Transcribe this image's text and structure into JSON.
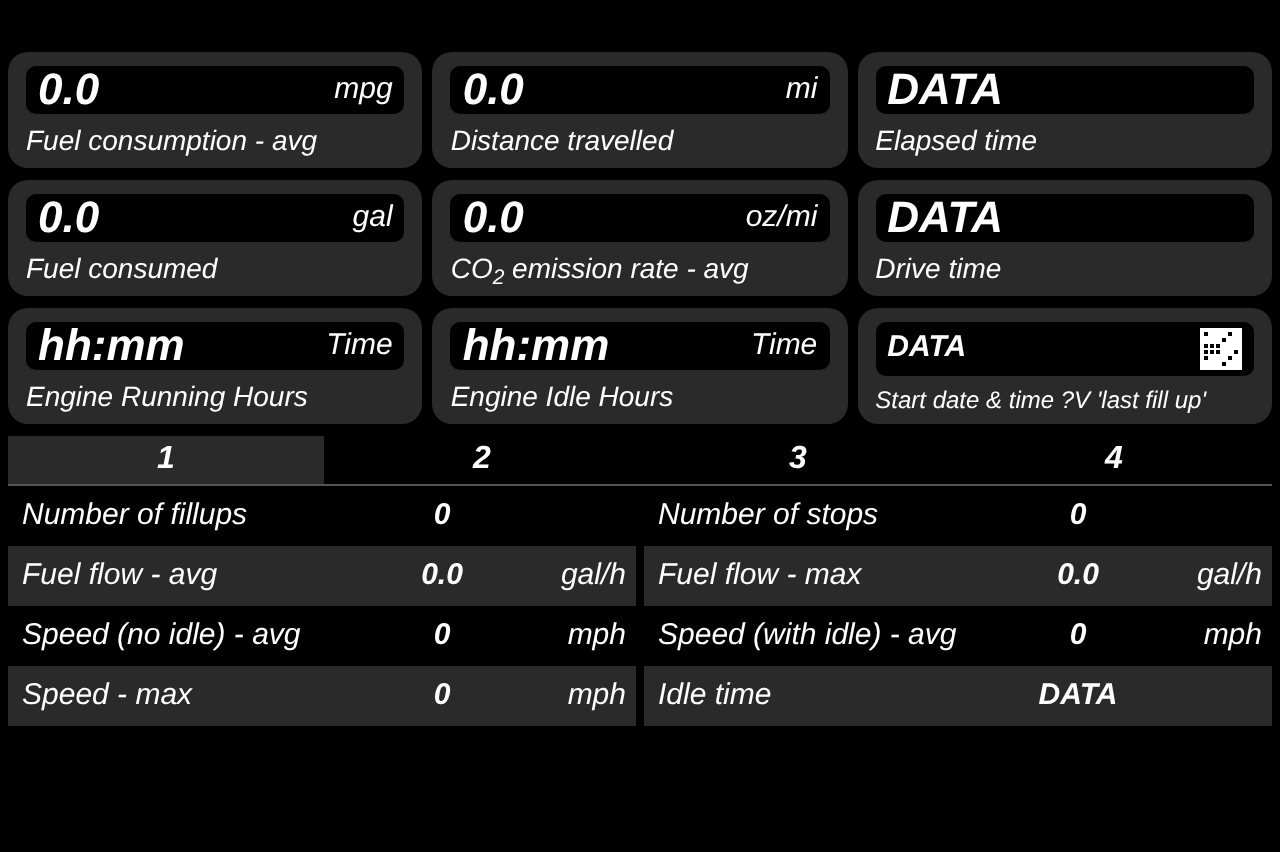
{
  "cards": [
    {
      "kind": "value",
      "value": "0.0",
      "unit": "mpg",
      "label": "Fuel consumption - avg"
    },
    {
      "kind": "value",
      "value": "0.0",
      "unit": "mi",
      "label": "Distance travelled"
    },
    {
      "kind": "value",
      "value": "DATA",
      "label": "Elapsed time"
    },
    {
      "kind": "value",
      "value": "0.0",
      "unit": "gal",
      "label": "Fuel consumed"
    },
    {
      "kind": "value",
      "value": "0.0",
      "unit": "oz/mi",
      "label": "CO$_{2}$ emission rate - avg"
    },
    {
      "kind": "value",
      "value": "DATA",
      "label": "Drive time"
    },
    {
      "kind": "value",
      "value": "hh:mm",
      "unit": "Time",
      "label": "Engine Running Hours"
    },
    {
      "kind": "value",
      "value": "hh:mm",
      "unit": "Time",
      "label": "Engine Idle Hours"
    },
    {
      "kind": "small",
      "value": "DATA",
      "label": "Start date & time ?V 'last fill up'"
    }
  ],
  "tabs": [
    {
      "label": "1",
      "selected": true
    },
    {
      "label": "2",
      "selected": false
    },
    {
      "label": "3",
      "selected": false
    },
    {
      "label": "4",
      "selected": false
    }
  ],
  "rows": [
    {
      "left": {
        "label": "Number of fillups",
        "value": "0"
      },
      "right": {
        "label": "Number of stops",
        "value": "0"
      }
    },
    {
      "left": {
        "label": "Fuel flow - avg",
        "value": "0.0",
        "unit": "gal/h"
      },
      "right": {
        "label": "Fuel flow - max",
        "value": "0.0",
        "unit": "gal/h"
      }
    },
    {
      "left": {
        "label": "Speed (no idle) - avg",
        "value": "0",
        "unit": "mph"
      },
      "right": {
        "label": "Speed (with idle) - avg",
        "value": "0",
        "unit": "mph"
      }
    },
    {
      "left": {
        "label": "Speed - max",
        "value": "0",
        "unit": "mph"
      },
      "right": {
        "label": "Idle time",
        "value": "DATA"
      }
    }
  ]
}
